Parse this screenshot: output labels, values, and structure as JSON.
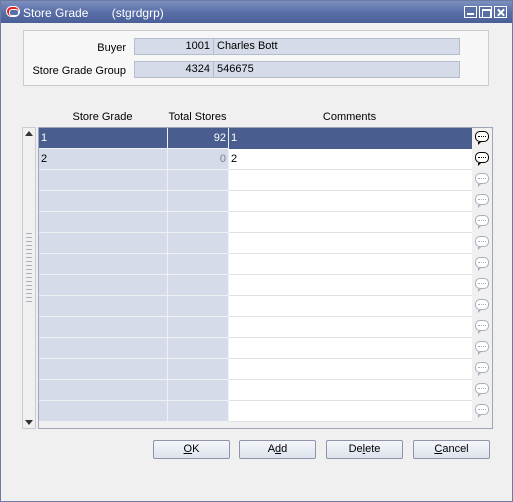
{
  "window": {
    "title": "Store Grade",
    "title_code": "(stgrdgrp)"
  },
  "header": {
    "buyer_label": "Buyer",
    "buyer_id": "1001",
    "buyer_name": "Charles Bott",
    "group_label": "Store Grade Group",
    "group_id": "4324",
    "group_name": "546675"
  },
  "grid": {
    "columns": [
      "Store Grade",
      "Total Stores",
      "Comments"
    ],
    "rows": [
      {
        "grade": "1",
        "total": "92",
        "comment": "1",
        "selected": true
      },
      {
        "grade": "2",
        "total": "0",
        "comment": "2",
        "selected": false
      }
    ],
    "empty_rows": 12
  },
  "buttons": {
    "ok": {
      "pre": "",
      "key": "O",
      "post": "K"
    },
    "add": {
      "pre": "A",
      "key": "d",
      "post": "d"
    },
    "delete": {
      "pre": "De",
      "key": "l",
      "post": "ete"
    },
    "cancel": {
      "pre": "",
      "key": "C",
      "post": "ancel"
    }
  },
  "colors": {
    "title_bar": "#5a6fa8",
    "selection": "#4a5d8f",
    "readonly_field": "#d5dbe8"
  },
  "icons": [
    "oracle-logo-icon",
    "minimize-icon",
    "maximize-icon",
    "close-icon",
    "comment-bubble-icon",
    "arrow-up-icon",
    "arrow-down-icon"
  ]
}
